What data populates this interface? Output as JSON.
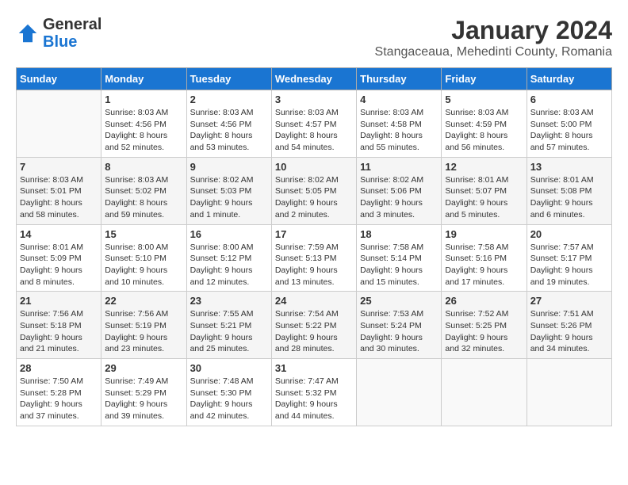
{
  "header": {
    "logo": {
      "general": "General",
      "blue": "Blue"
    },
    "title": "January 2024",
    "location": "Stangaceaua, Mehedinti County, Romania"
  },
  "weekdays": [
    "Sunday",
    "Monday",
    "Tuesday",
    "Wednesday",
    "Thursday",
    "Friday",
    "Saturday"
  ],
  "weeks": [
    [
      {
        "day": "",
        "sunrise": "",
        "sunset": "",
        "daylight": ""
      },
      {
        "day": "1",
        "sunrise": "Sunrise: 8:03 AM",
        "sunset": "Sunset: 4:56 PM",
        "daylight": "Daylight: 8 hours and 52 minutes."
      },
      {
        "day": "2",
        "sunrise": "Sunrise: 8:03 AM",
        "sunset": "Sunset: 4:56 PM",
        "daylight": "Daylight: 8 hours and 53 minutes."
      },
      {
        "day": "3",
        "sunrise": "Sunrise: 8:03 AM",
        "sunset": "Sunset: 4:57 PM",
        "daylight": "Daylight: 8 hours and 54 minutes."
      },
      {
        "day": "4",
        "sunrise": "Sunrise: 8:03 AM",
        "sunset": "Sunset: 4:58 PM",
        "daylight": "Daylight: 8 hours and 55 minutes."
      },
      {
        "day": "5",
        "sunrise": "Sunrise: 8:03 AM",
        "sunset": "Sunset: 4:59 PM",
        "daylight": "Daylight: 8 hours and 56 minutes."
      },
      {
        "day": "6",
        "sunrise": "Sunrise: 8:03 AM",
        "sunset": "Sunset: 5:00 PM",
        "daylight": "Daylight: 8 hours and 57 minutes."
      }
    ],
    [
      {
        "day": "7",
        "sunrise": "Sunrise: 8:03 AM",
        "sunset": "Sunset: 5:01 PM",
        "daylight": "Daylight: 8 hours and 58 minutes."
      },
      {
        "day": "8",
        "sunrise": "Sunrise: 8:03 AM",
        "sunset": "Sunset: 5:02 PM",
        "daylight": "Daylight: 8 hours and 59 minutes."
      },
      {
        "day": "9",
        "sunrise": "Sunrise: 8:02 AM",
        "sunset": "Sunset: 5:03 PM",
        "daylight": "Daylight: 9 hours and 1 minute."
      },
      {
        "day": "10",
        "sunrise": "Sunrise: 8:02 AM",
        "sunset": "Sunset: 5:05 PM",
        "daylight": "Daylight: 9 hours and 2 minutes."
      },
      {
        "day": "11",
        "sunrise": "Sunrise: 8:02 AM",
        "sunset": "Sunset: 5:06 PM",
        "daylight": "Daylight: 9 hours and 3 minutes."
      },
      {
        "day": "12",
        "sunrise": "Sunrise: 8:01 AM",
        "sunset": "Sunset: 5:07 PM",
        "daylight": "Daylight: 9 hours and 5 minutes."
      },
      {
        "day": "13",
        "sunrise": "Sunrise: 8:01 AM",
        "sunset": "Sunset: 5:08 PM",
        "daylight": "Daylight: 9 hours and 6 minutes."
      }
    ],
    [
      {
        "day": "14",
        "sunrise": "Sunrise: 8:01 AM",
        "sunset": "Sunset: 5:09 PM",
        "daylight": "Daylight: 9 hours and 8 minutes."
      },
      {
        "day": "15",
        "sunrise": "Sunrise: 8:00 AM",
        "sunset": "Sunset: 5:10 PM",
        "daylight": "Daylight: 9 hours and 10 minutes."
      },
      {
        "day": "16",
        "sunrise": "Sunrise: 8:00 AM",
        "sunset": "Sunset: 5:12 PM",
        "daylight": "Daylight: 9 hours and 12 minutes."
      },
      {
        "day": "17",
        "sunrise": "Sunrise: 7:59 AM",
        "sunset": "Sunset: 5:13 PM",
        "daylight": "Daylight: 9 hours and 13 minutes."
      },
      {
        "day": "18",
        "sunrise": "Sunrise: 7:58 AM",
        "sunset": "Sunset: 5:14 PM",
        "daylight": "Daylight: 9 hours and 15 minutes."
      },
      {
        "day": "19",
        "sunrise": "Sunrise: 7:58 AM",
        "sunset": "Sunset: 5:16 PM",
        "daylight": "Daylight: 9 hours and 17 minutes."
      },
      {
        "day": "20",
        "sunrise": "Sunrise: 7:57 AM",
        "sunset": "Sunset: 5:17 PM",
        "daylight": "Daylight: 9 hours and 19 minutes."
      }
    ],
    [
      {
        "day": "21",
        "sunrise": "Sunrise: 7:56 AM",
        "sunset": "Sunset: 5:18 PM",
        "daylight": "Daylight: 9 hours and 21 minutes."
      },
      {
        "day": "22",
        "sunrise": "Sunrise: 7:56 AM",
        "sunset": "Sunset: 5:19 PM",
        "daylight": "Daylight: 9 hours and 23 minutes."
      },
      {
        "day": "23",
        "sunrise": "Sunrise: 7:55 AM",
        "sunset": "Sunset: 5:21 PM",
        "daylight": "Daylight: 9 hours and 25 minutes."
      },
      {
        "day": "24",
        "sunrise": "Sunrise: 7:54 AM",
        "sunset": "Sunset: 5:22 PM",
        "daylight": "Daylight: 9 hours and 28 minutes."
      },
      {
        "day": "25",
        "sunrise": "Sunrise: 7:53 AM",
        "sunset": "Sunset: 5:24 PM",
        "daylight": "Daylight: 9 hours and 30 minutes."
      },
      {
        "day": "26",
        "sunrise": "Sunrise: 7:52 AM",
        "sunset": "Sunset: 5:25 PM",
        "daylight": "Daylight: 9 hours and 32 minutes."
      },
      {
        "day": "27",
        "sunrise": "Sunrise: 7:51 AM",
        "sunset": "Sunset: 5:26 PM",
        "daylight": "Daylight: 9 hours and 34 minutes."
      }
    ],
    [
      {
        "day": "28",
        "sunrise": "Sunrise: 7:50 AM",
        "sunset": "Sunset: 5:28 PM",
        "daylight": "Daylight: 9 hours and 37 minutes."
      },
      {
        "day": "29",
        "sunrise": "Sunrise: 7:49 AM",
        "sunset": "Sunset: 5:29 PM",
        "daylight": "Daylight: 9 hours and 39 minutes."
      },
      {
        "day": "30",
        "sunrise": "Sunrise: 7:48 AM",
        "sunset": "Sunset: 5:30 PM",
        "daylight": "Daylight: 9 hours and 42 minutes."
      },
      {
        "day": "31",
        "sunrise": "Sunrise: 7:47 AM",
        "sunset": "Sunset: 5:32 PM",
        "daylight": "Daylight: 9 hours and 44 minutes."
      },
      {
        "day": "",
        "sunrise": "",
        "sunset": "",
        "daylight": ""
      },
      {
        "day": "",
        "sunrise": "",
        "sunset": "",
        "daylight": ""
      },
      {
        "day": "",
        "sunrise": "",
        "sunset": "",
        "daylight": ""
      }
    ]
  ]
}
